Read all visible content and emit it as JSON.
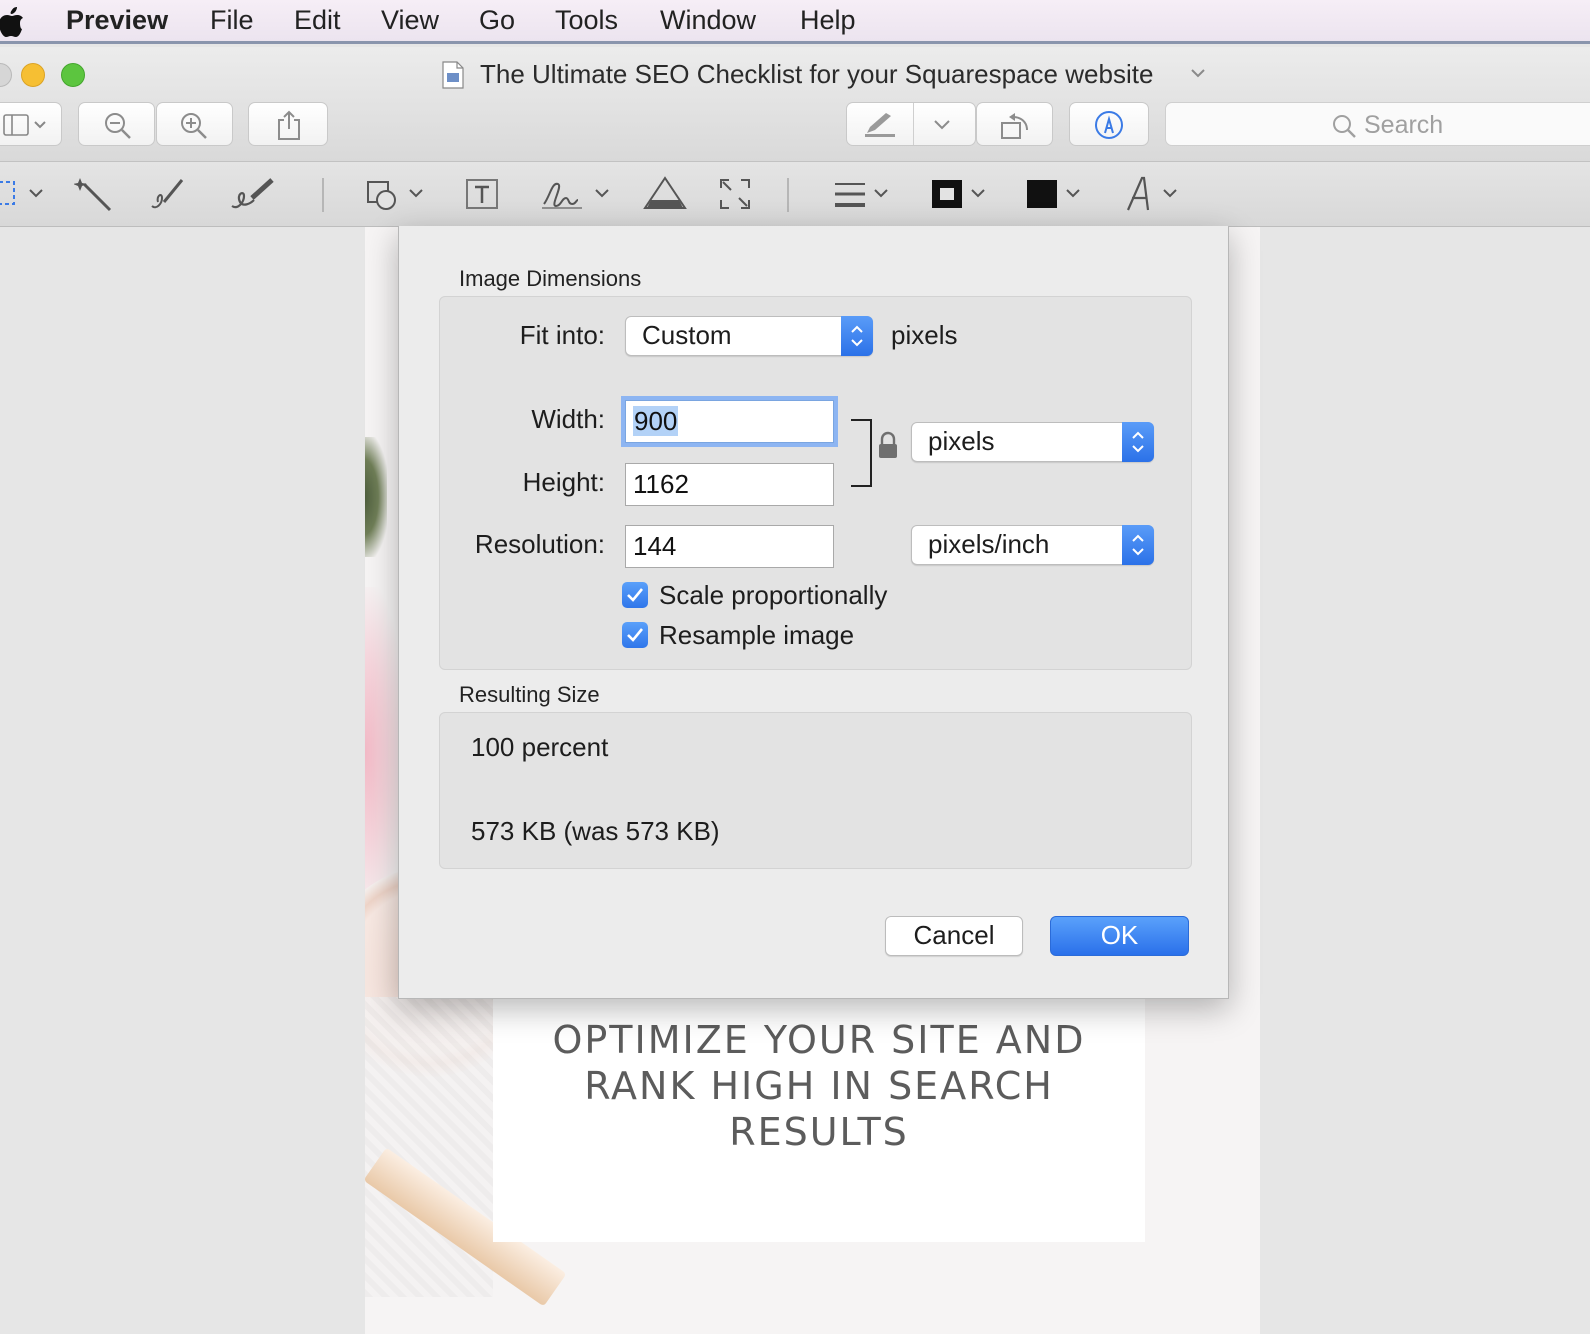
{
  "menubar": {
    "app_name": "Preview",
    "items": [
      "File",
      "Edit",
      "View",
      "Go",
      "Tools",
      "Window",
      "Help"
    ]
  },
  "window": {
    "title": "The Ultimate SEO Checklist for your Squarespace website"
  },
  "toolbar": {
    "search_placeholder": "Search",
    "icons": [
      "sidebar-icon",
      "zoom-out-icon",
      "zoom-in-icon",
      "share-icon",
      "highlight-icon",
      "rotate-icon",
      "markup-icon",
      "search-icon"
    ]
  },
  "markup_toolbar": {
    "icons": [
      "rectangular-selection-icon",
      "instant-alpha-icon",
      "sketch-icon",
      "draw-icon",
      "shapes-icon",
      "text-icon",
      "sign-icon",
      "adjust-color-icon",
      "adjust-size-icon",
      "shape-style-icon",
      "border-color-icon",
      "fill-color-icon",
      "text-style-icon"
    ]
  },
  "dialog": {
    "image_dimensions_title": "Image Dimensions",
    "fit_into_label": "Fit into:",
    "fit_into_value": "Custom",
    "fit_into_unit": "pixels",
    "width_label": "Width:",
    "width_value": "900",
    "height_label": "Height:",
    "height_value": "1162",
    "resolution_label": "Resolution:",
    "resolution_value": "144",
    "size_unit": "pixels",
    "resolution_unit": "pixels/inch",
    "scale_proportionally_label": "Scale proportionally",
    "scale_proportionally_checked": true,
    "resample_label": "Resample image",
    "resample_checked": true,
    "resulting_size_title": "Resulting Size",
    "result_percent": "100 percent",
    "result_size": "573 KB (was 573 KB)",
    "cancel_label": "Cancel",
    "ok_label": "OK"
  },
  "document": {
    "headline_lines": [
      "OPTIMIZE YOUR SITE AND",
      "RANK HIGH IN SEARCH",
      "RESULTS"
    ]
  },
  "colors": {
    "accent": "#2f76ea",
    "focus_ring": "#8db5f2",
    "menubar_bg": "#f6eef6"
  }
}
